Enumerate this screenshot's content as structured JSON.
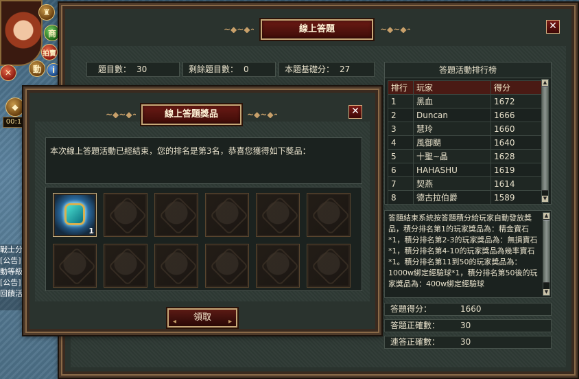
{
  "hud": {
    "buttons": [
      "商",
      "拍賣",
      "動",
      "活"
    ],
    "timer": "00:1",
    "chat_lines": [
      "戰士分",
      "[公告]",
      "動等級",
      "[公告]",
      "回饋活"
    ]
  },
  "quiz_window": {
    "title": "線上答題",
    "close": "✕",
    "stats": {
      "question_count_label": "題目數：",
      "question_count": "30",
      "remaining_label": "剩餘題目數：",
      "remaining": "0",
      "base_score_label": "本題基礎分：",
      "base_score": "27"
    },
    "leaderboard": {
      "title": "答題活動排行榜",
      "headers": [
        "排行",
        "玩家",
        "得分"
      ],
      "rows": [
        [
          "1",
          "黑血",
          "1672"
        ],
        [
          "2",
          "Duncan",
          "1666"
        ],
        [
          "3",
          "慧玲",
          "1660"
        ],
        [
          "4",
          "風御颶",
          "1640"
        ],
        [
          "5",
          "十聖~晶",
          "1628"
        ],
        [
          "6",
          "HAHASHU",
          "1619"
        ],
        [
          "7",
          "契燕",
          "1614"
        ],
        [
          "8",
          "德古拉伯爵",
          "1589"
        ]
      ]
    },
    "description": "答題結束系統按答題積分給玩家自動發放獎品，積分排名第1的玩家獎品為：精金寶石*1，積分排名第2-3的玩家獎品為：無損寶石*1，積分排名第4-10的玩家獎品為幾率寶石*1。積分排名第11到50的玩家獎品為：1000w綁定經驗球*1，積分排名第50後的玩家獎品為：400w綁定經驗球",
    "scores": [
      {
        "label": "答題得分：",
        "value": "1660"
      },
      {
        "label": "答題正確數：",
        "value": "30"
      },
      {
        "label": "連答正確數：",
        "value": "30"
      }
    ]
  },
  "reward_dialog": {
    "title": "線上答題獎品",
    "close": "✕",
    "message": "本次線上答題活動已經結束，您的排名是第3名，恭喜您獲得如下獎品：",
    "first_item_qty": "1",
    "claim_label": "領取"
  }
}
